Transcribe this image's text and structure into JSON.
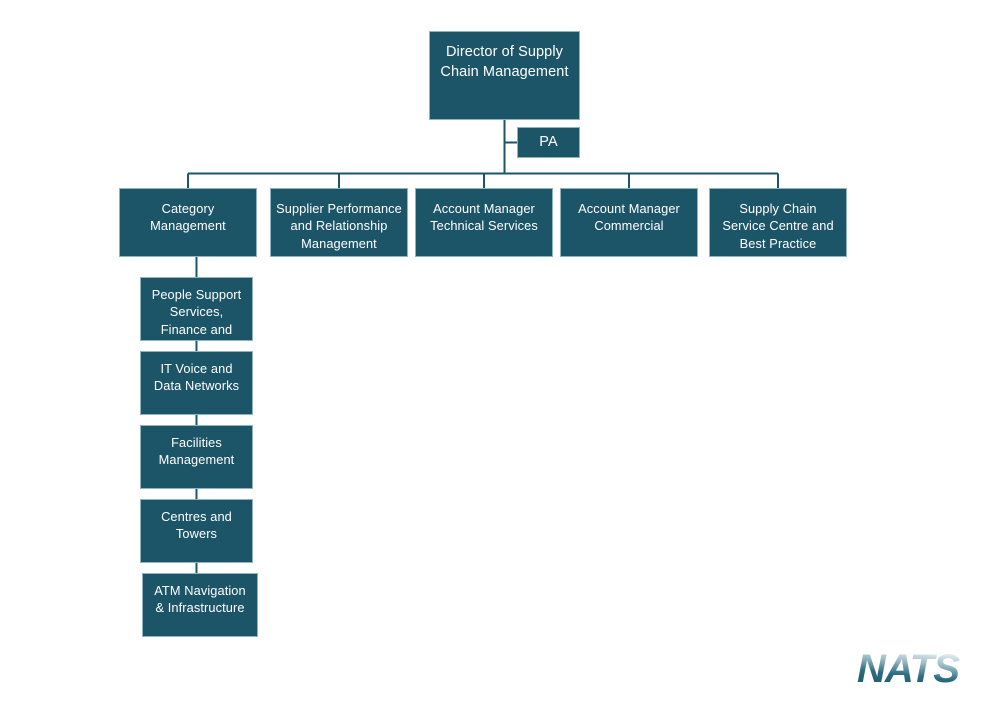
{
  "page": {
    "background_color": "#ffffff",
    "box_fill_color": "#1c5568",
    "box_border_color": "#8fb4c0",
    "text_color": "#ffffff",
    "connector_color": "#1c5568",
    "logo_color_dark": "#1c5568",
    "logo_color_light": "#6f9aa8"
  },
  "org_chart": {
    "type": "diagram",
    "title": "",
    "root": {
      "id": "director",
      "label": "Director of Supply\nChain Management"
    },
    "assistant": {
      "id": "pa",
      "label": "PA"
    },
    "divisions": [
      {
        "id": "category",
        "label": "Category\nManagement"
      },
      {
        "id": "supplier",
        "label": "Supplier Performance\nand Relationship\nManagement"
      },
      {
        "id": "amts",
        "label": "Account Manager\nTechnical Services"
      },
      {
        "id": "amc",
        "label": "Account Manager\nCommercial"
      },
      {
        "id": "scsc",
        "label": "Supply Chain\nService Centre and\nBest Practice"
      }
    ],
    "category_children": [
      {
        "id": "people",
        "label": "People Support\nServices,\nFinance and"
      },
      {
        "id": "itvoice",
        "label": "IT Voice and\nData Networks"
      },
      {
        "id": "facilities",
        "label": "Facilities\nManagement"
      },
      {
        "id": "centres",
        "label": "Centres and\nTowers"
      },
      {
        "id": "atm",
        "label": "ATM Navigation\n& Infrastructure"
      }
    ]
  },
  "logo": {
    "name": "nats-logo",
    "text": "NATS"
  }
}
